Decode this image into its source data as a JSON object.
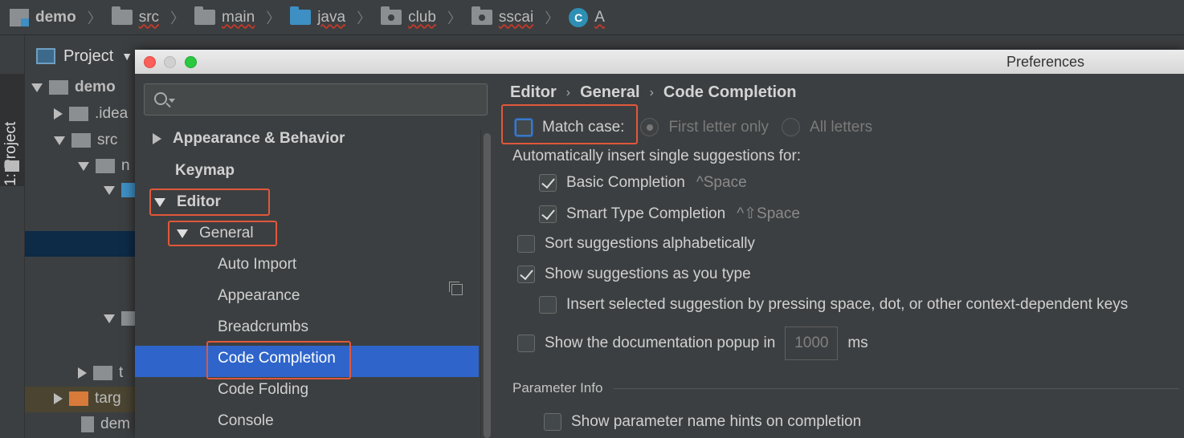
{
  "topbar": {
    "crumbs": [
      "demo",
      "src",
      "main",
      "java",
      "club",
      "sscai",
      "A"
    ],
    "class_icon_letter": "C"
  },
  "toolwindow": {
    "tab_label": "1: Project"
  },
  "project": {
    "header": "Project",
    "items": [
      "demo",
      ".idea",
      "src",
      "n",
      "t",
      "targ",
      "dem"
    ]
  },
  "prefs": {
    "title": "Preferences",
    "search": {
      "value": "",
      "placeholder": ""
    },
    "tree": {
      "appearance_behavior": "Appearance & Behavior",
      "keymap": "Keymap",
      "editor": "Editor",
      "general": "General",
      "auto_import": "Auto Import",
      "appearance": "Appearance",
      "breadcrumbs": "Breadcrumbs",
      "code_completion": "Code Completion",
      "code_folding": "Code Folding",
      "console": "Console"
    },
    "breadcrumb": [
      "Editor",
      "General",
      "Code Completion"
    ],
    "settings": {
      "match_case": "Match case:",
      "first_letter_only": "First letter only",
      "all_letters": "All letters",
      "auto_insert": "Automatically insert single suggestions for:",
      "basic_completion": "Basic Completion",
      "basic_shortcut": "^Space",
      "smart_completion": "Smart Type Completion",
      "smart_shortcut": "^⇧Space",
      "sort_alpha": "Sort suggestions alphabetically",
      "show_as_type": "Show suggestions as you type",
      "insert_selected": "Insert selected suggestion by pressing space, dot, or other context-dependent keys",
      "doc_popup": "Show the documentation popup in",
      "doc_popup_value": "1000",
      "doc_popup_unit": "ms",
      "parameter_info": "Parameter Info",
      "param_hints": "Show parameter name hints on completion"
    }
  },
  "colors": {
    "highlight": "#e0583b",
    "selection": "#2f65ca",
    "background": "#3c3f41"
  }
}
